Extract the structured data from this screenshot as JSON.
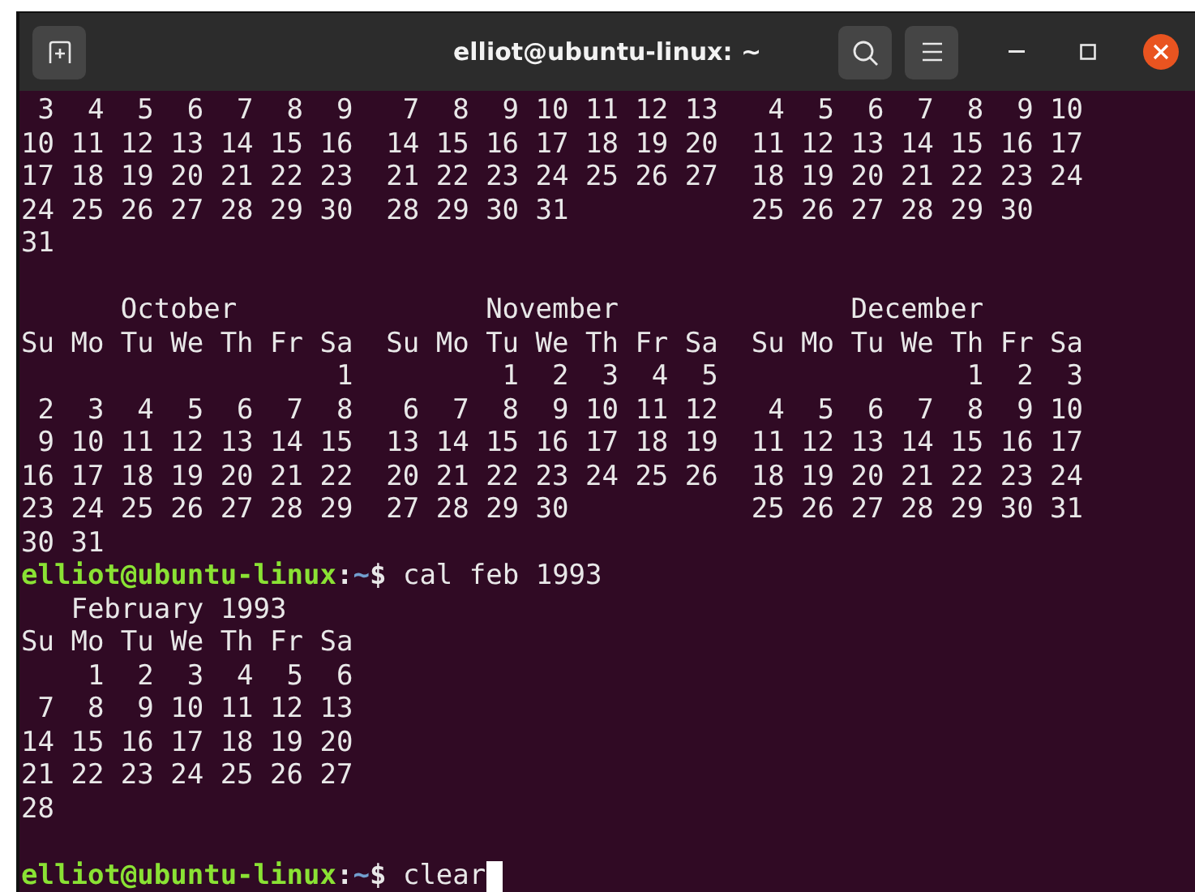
{
  "window": {
    "title": "elliot@ubuntu-linux: ~"
  },
  "terminal": {
    "lines": [
      {
        "kind": "output",
        "text": " 3  4  5  6  7  8  9   7  8  9 10 11 12 13   4  5  6  7  8  9 10"
      },
      {
        "kind": "output",
        "text": "10 11 12 13 14 15 16  14 15 16 17 18 19 20  11 12 13 14 15 16 17"
      },
      {
        "kind": "output",
        "text": "17 18 19 20 21 22 23  21 22 23 24 25 26 27  18 19 20 21 22 23 24"
      },
      {
        "kind": "output",
        "text": "24 25 26 27 28 29 30  28 29 30 31           25 26 27 28 29 30"
      },
      {
        "kind": "output",
        "text": "31"
      },
      {
        "kind": "blank"
      },
      {
        "kind": "output",
        "text": "      October               November              December"
      },
      {
        "kind": "output",
        "text": "Su Mo Tu We Th Fr Sa  Su Mo Tu We Th Fr Sa  Su Mo Tu We Th Fr Sa"
      },
      {
        "kind": "output",
        "text": "                   1         1  2  3  4  5               1  2  3"
      },
      {
        "kind": "output",
        "text": " 2  3  4  5  6  7  8   6  7  8  9 10 11 12   4  5  6  7  8  9 10"
      },
      {
        "kind": "output",
        "text": " 9 10 11 12 13 14 15  13 14 15 16 17 18 19  11 12 13 14 15 16 17"
      },
      {
        "kind": "output",
        "text": "16 17 18 19 20 21 22  20 21 22 23 24 25 26  18 19 20 21 22 23 24"
      },
      {
        "kind": "output",
        "text": "23 24 25 26 27 28 29  27 28 29 30           25 26 27 28 29 30 31"
      },
      {
        "kind": "output",
        "text": "30 31"
      },
      {
        "kind": "prompt",
        "user": "elliot@ubuntu-linux",
        "separator": ":",
        "path": "~",
        "symbol": "$",
        "command": "cal feb 1993",
        "cursor": false
      },
      {
        "kind": "output",
        "text": "   February 1993"
      },
      {
        "kind": "output",
        "text": "Su Mo Tu We Th Fr Sa"
      },
      {
        "kind": "output",
        "text": "    1  2  3  4  5  6"
      },
      {
        "kind": "output",
        "text": " 7  8  9 10 11 12 13"
      },
      {
        "kind": "output",
        "text": "14 15 16 17 18 19 20"
      },
      {
        "kind": "output",
        "text": "21 22 23 24 25 26 27"
      },
      {
        "kind": "output",
        "text": "28"
      },
      {
        "kind": "blank"
      },
      {
        "kind": "prompt",
        "user": "elliot@ubuntu-linux",
        "separator": ":",
        "path": "~",
        "symbol": "$",
        "command": "clear",
        "cursor": true
      }
    ]
  }
}
